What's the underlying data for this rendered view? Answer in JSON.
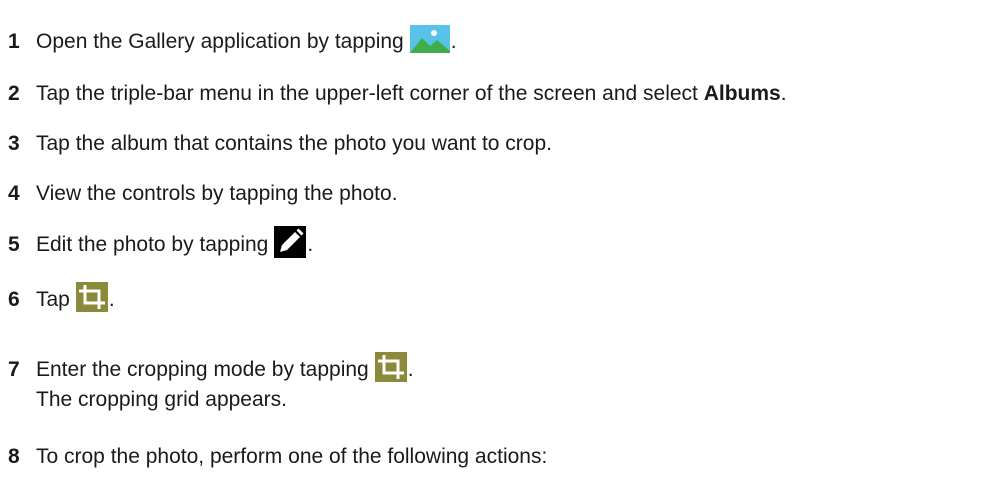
{
  "steps": [
    {
      "number": "1",
      "text": "Open the Gallery application by tapping",
      "icon": "gallery-icon",
      "trail": "."
    },
    {
      "number": "2",
      "text": "Tap the triple-bar menu in the upper-left corner of the screen and select ",
      "bold": "Albums",
      "trail": "."
    },
    {
      "number": "3",
      "text": "Tap the album that contains the photo you want to crop."
    },
    {
      "number": "4",
      "text": "View the controls by tapping the photo."
    },
    {
      "number": "5",
      "text": "Edit the photo by tapping",
      "icon": "pencil-icon",
      "trail": "."
    },
    {
      "number": "6",
      "text": "Tap",
      "icon": "crop-icon",
      "trail": "."
    },
    {
      "number": "7",
      "text": "Enter the cropping mode by tapping",
      "icon": "crop-icon",
      "trail": ".",
      "note": "The cropping grid appears."
    },
    {
      "number": "8",
      "text": "To crop the photo, perform one of the following actions:"
    }
  ],
  "colors": {
    "gallery_sky": "#58c2e8",
    "gallery_hills": "#3fae49",
    "crop_icon_bg": "#8a8a3a",
    "pencil_bg": "#000000"
  }
}
